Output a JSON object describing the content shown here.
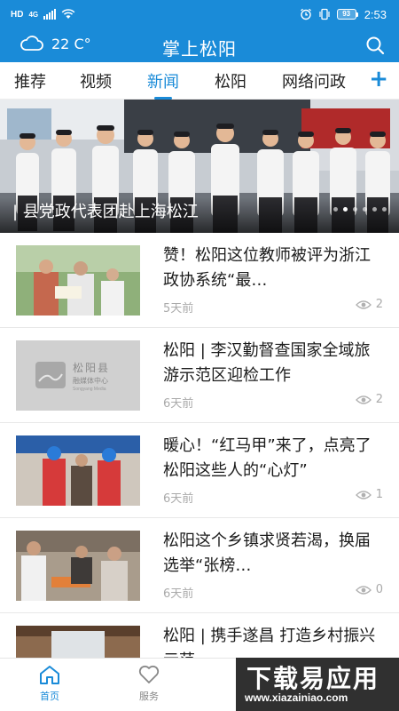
{
  "status_bar": {
    "hd": "HD",
    "net": "4G",
    "battery": "93",
    "time": "2:53"
  },
  "header": {
    "temperature": "22 C°",
    "title": "掌上松阳",
    "weather_icon": "cloud-icon",
    "search_icon": "search-icon"
  },
  "tabs": [
    {
      "label": "推荐"
    },
    {
      "label": "视频"
    },
    {
      "label": "新闻"
    },
    {
      "label": "松阳"
    },
    {
      "label": "网络问政"
    }
  ],
  "active_tab": "新闻",
  "tab_add": "+",
  "banner": {
    "caption": "县党政代表团赴上海松江",
    "dots": 6,
    "active_dot": 1
  },
  "news": [
    {
      "title": "赞！松阳这位教师被评为浙江政协系统“最…",
      "time": "5天前",
      "views": "2"
    },
    {
      "title": "松阳 | 李汉勤督查国家全域旅游示范区迎检工作",
      "time": "6天前",
      "views": "2",
      "thumb_logo": "松阳县",
      "thumb_sub": "融媒体中心",
      "thumb_en": "Songyang Media"
    },
    {
      "title": "暖心！“红马甲”来了，点亮了松阳这些人的“心灯”",
      "time": "6天前",
      "views": "1"
    },
    {
      "title": "松阳这个乡镇求贤若渴，换届选举“张榜…",
      "time": "6天前",
      "views": "0"
    },
    {
      "title": "松阳 | 携手遂昌 打造乡村振兴示范",
      "time": "",
      "views": ""
    }
  ],
  "bottom_nav": {
    "home": "首页",
    "service": "服务"
  },
  "watermark": {
    "main": "下载易应用",
    "url": "www.xiazainiao.com"
  },
  "colors": {
    "brand": "#1a8bd8",
    "text": "#1b1b1b",
    "muted": "#aaaaaa"
  }
}
